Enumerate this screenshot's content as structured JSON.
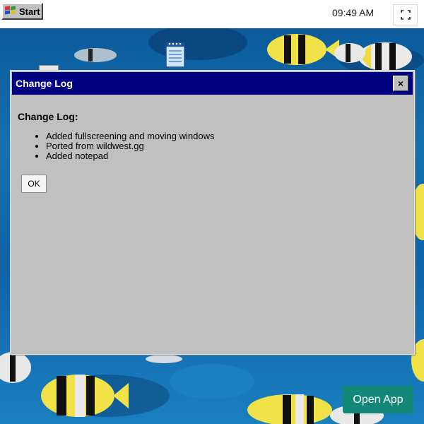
{
  "taskbar": {
    "start_label": "Start",
    "clock": "09:49 AM"
  },
  "window": {
    "title": "Change Log",
    "close_label": "×",
    "heading": "Change Log:",
    "items": [
      "Added fullscreening and moving windows",
      "Ported from wildwest.gg",
      "Added notepad"
    ],
    "ok_label": "OK"
  },
  "open_app_label": "Open App",
  "icons": {
    "start": "windows-logo-icon",
    "fullscreen": "fullscreen-icon",
    "desktop": "notepad-icon"
  },
  "colors": {
    "titlebar": "#000080",
    "window_bg": "#c0c0c0",
    "open_app": "#148878"
  }
}
